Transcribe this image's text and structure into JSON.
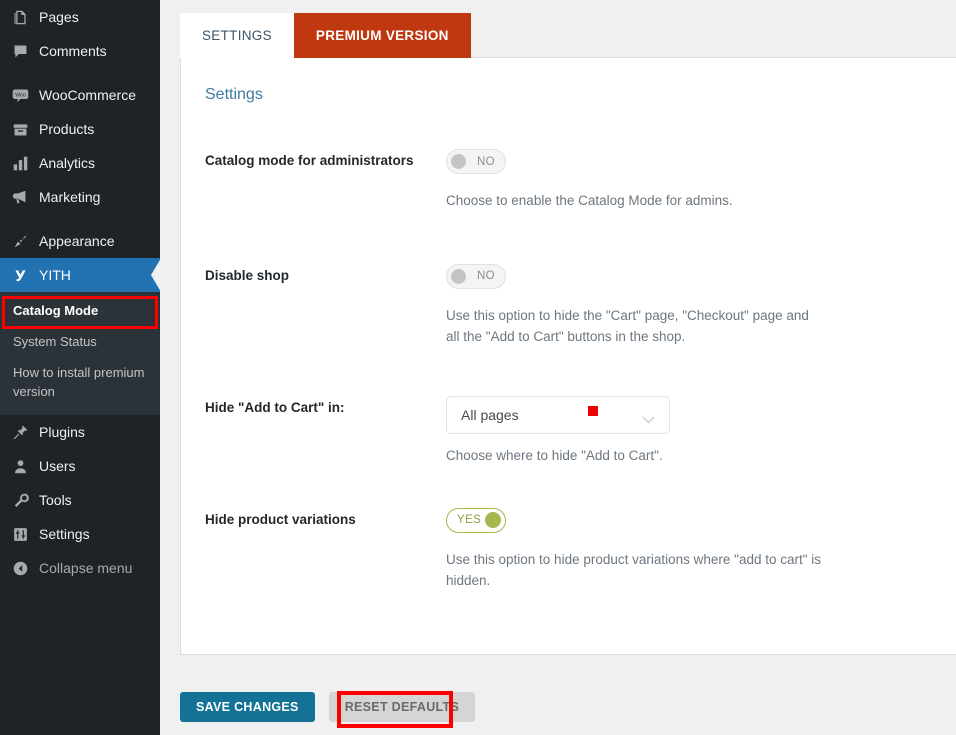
{
  "colors": {
    "sidebar_bg": "#1d2327",
    "submenu_bg": "#2c3338",
    "current_menu": "#2271b1",
    "premium_tab": "#c0380f",
    "heading": "#3f7b9e",
    "toggle_on": "#a4b84b",
    "primary_button": "#137295",
    "highlight": "#ff0000"
  },
  "sidebar": {
    "items": [
      {
        "label": "Pages",
        "icon": "pages-icon"
      },
      {
        "label": "Comments",
        "icon": "comments-icon"
      },
      {
        "label": "WooCommerce",
        "icon": "woocommerce-icon"
      },
      {
        "label": "Products",
        "icon": "products-icon"
      },
      {
        "label": "Analytics",
        "icon": "analytics-icon"
      },
      {
        "label": "Marketing",
        "icon": "marketing-icon"
      },
      {
        "label": "Appearance",
        "icon": "appearance-icon"
      },
      {
        "label": "YITH",
        "icon": "yith-icon"
      },
      {
        "label": "Plugins",
        "icon": "plugins-icon"
      },
      {
        "label": "Users",
        "icon": "users-icon"
      },
      {
        "label": "Tools",
        "icon": "tools-icon"
      },
      {
        "label": "Settings",
        "icon": "settings-icon"
      },
      {
        "label": "Collapse menu",
        "icon": "collapse-icon"
      }
    ],
    "submenu": [
      {
        "label": "Catalog Mode",
        "active": true
      },
      {
        "label": "System Status",
        "active": false
      },
      {
        "label": "How to install premium version",
        "active": false
      }
    ]
  },
  "tabs": [
    {
      "label": "SETTINGS",
      "state": "active"
    },
    {
      "label": "PREMIUM VERSION",
      "state": "premium"
    }
  ],
  "panel": {
    "title": "Settings",
    "rows": [
      {
        "label": "Catalog mode for administrators",
        "control": "toggle",
        "value": "NO",
        "state": "off",
        "description": "Choose to enable the Catalog Mode for admins."
      },
      {
        "label": "Disable shop",
        "control": "toggle",
        "value": "NO",
        "state": "off",
        "description": "Use this option to hide the \"Cart\" page, \"Checkout\" page and all the \"Add to Cart\" buttons in the shop."
      },
      {
        "label": "Hide \"Add to Cart\" in:",
        "control": "select",
        "value": "All pages",
        "description": "Choose where to hide \"Add to Cart\"."
      },
      {
        "label": "Hide product variations",
        "control": "toggle",
        "value": "YES",
        "state": "on",
        "description": "Use this option to hide product variations where \"add to cart\" is hidden."
      }
    ]
  },
  "footer": {
    "save_label": "SAVE CHANGES",
    "reset_label": "RESET DEFAULTS"
  }
}
